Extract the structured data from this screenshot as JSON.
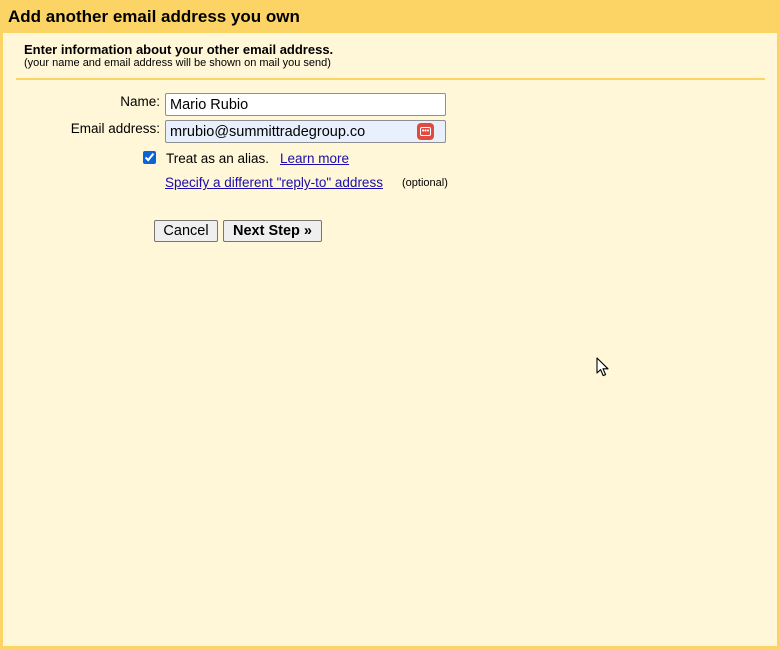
{
  "dialog": {
    "title": "Add another email address you own",
    "intro_heading": "Enter information about your other email address.",
    "intro_sub": "(your name and email address will be shown on mail you send)"
  },
  "form": {
    "name_label": "Name:",
    "name_value": "Mario Rubio",
    "email_label": "Email address:",
    "email_value": "mrubio@summittradegroup.co",
    "alias_checked": true,
    "alias_label": "Treat as an alias.",
    "learn_more_link": "Learn more",
    "reply_to_link": "Specify a different \"reply-to\" address",
    "reply_to_optional": "(optional)"
  },
  "buttons": {
    "cancel_label": "Cancel",
    "next_label": "Next Step »"
  },
  "icons": {
    "password_manager": "password-manager-icon",
    "cursor": "mouse-pointer-icon"
  },
  "colors": {
    "title_bar": "#fcd466",
    "background": "#fff7d7",
    "link": "#1a0dab",
    "autofill": "#e8f0fe",
    "password_icon": "#e04a3f"
  }
}
